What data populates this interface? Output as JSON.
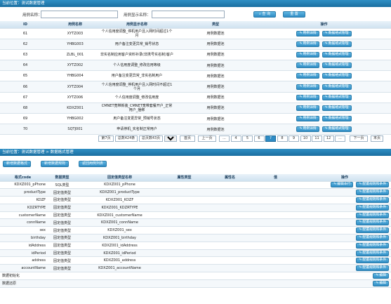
{
  "top": {
    "location": "当前位置：测试数据管理",
    "search": {
      "name_label": "用例名称：",
      "display_label": "用例显示名称：",
      "query_button": "查 询",
      "reset_button": "重 置"
    },
    "columns": [
      "ID",
      "用例名称",
      "用例显示名称",
      "类型",
      "操作"
    ],
    "rows": [
      {
        "id": "61",
        "name": "XYTZ003",
        "display": "个人信用度调整_停机用户且入网时间超过1个月",
        "type": "用例数据池"
      },
      {
        "id": "62",
        "name": "YHBG003",
        "display": "用户备注变更异常_销号状态",
        "type": "用例数据池"
      },
      {
        "id": "63",
        "name": "ZLBL_001",
        "display": "非实名制应用客户资料补录(非携号实名制)客户",
        "type": "用例数据池"
      },
      {
        "id": "64",
        "name": "XYTZ002",
        "display": "个人信用度调整_修改信用等级",
        "type": "用例数据池"
      },
      {
        "id": "65",
        "name": "YHBG004",
        "display": "用户备注变更异常_非实名制用户",
        "type": "用例数据池"
      },
      {
        "id": "66",
        "name": "XYTZ004",
        "display": "个人信用度调整_停机用户且入网时间不超过1个月",
        "type": "用例数据池"
      },
      {
        "id": "67",
        "name": "XYTZ006",
        "display": "个人信用度调整_修改信用度",
        "type": "用例数据池"
      },
      {
        "id": "68",
        "name": "KDXZ001",
        "display": "CMNET宽带新装_CMNET宽带套餐开户_正常用户_捆绑",
        "type": "用例数据池"
      },
      {
        "id": "69",
        "name": "YHBG002",
        "display": "用户备注变更异常_预销号状态",
        "type": "用例数据池"
      },
      {
        "id": "70",
        "name": "SQTJ001",
        "display": "申请停机_实名制正常用户",
        "type": "用例数据池"
      }
    ],
    "row_buttons": [
      "用例详情",
      "数据格式管理"
    ],
    "pager": {
      "page_info": "第7页",
      "total_records": "总数424条",
      "total_pages": "总页数43页",
      "page_size": "10",
      "first": "首页",
      "prev": "上一页",
      "pages": [
        "...",
        "4",
        "5",
        "6",
        "7",
        "8",
        "9",
        "10",
        "11",
        "12",
        "..."
      ],
      "current": "7",
      "next": "下一页",
      "last": "末页"
    }
  },
  "bottom": {
    "location": "当前位置：测试数据管理 > 数据格式管理",
    "buttons": [
      "新增数据格式",
      "新增数据规则",
      "返回用例列表"
    ],
    "columns": [
      "格式code",
      "数据类型",
      "固定值类型名称",
      "属性类型",
      "属性名",
      "值",
      "操作"
    ],
    "rows": [
      {
        "code": "KDXZ001_pPhone",
        "dtype": "SQL类型",
        "fixed": "KDXZ001_pPhone",
        "ops": [
          "编辑本行",
          "配置规则和条件"
        ]
      },
      {
        "code": "productType",
        "dtype": "固定值类型",
        "fixed": "KDXZ001_productType",
        "ops": [
          "配置规则和条件"
        ]
      },
      {
        "code": "KDZF",
        "dtype": "固定值类型",
        "fixed": "KDXZ001_KDZF",
        "ops": [
          "配置规则和条件"
        ]
      },
      {
        "code": "KDZRTYPE",
        "dtype": "固定值类型",
        "fixed": "KDXZ001_KDZRTYPE",
        "ops": [
          "配置规则和条件"
        ]
      },
      {
        "code": "customerName",
        "dtype": "固定值类型",
        "fixed": "KDXZ001_customerName",
        "ops": [
          "配置规则和条件"
        ]
      },
      {
        "code": "connName",
        "dtype": "固定值类型",
        "fixed": "KDXZ001_connName",
        "ops": [
          "配置规则和条件"
        ]
      },
      {
        "code": "sex",
        "dtype": "固定值类型",
        "fixed": "KDXZ001_sex",
        "ops": [
          "配置规则和条件"
        ]
      },
      {
        "code": "birthday",
        "dtype": "固定值类型",
        "fixed": "KDXZ001_birthday",
        "ops": [
          "配置规则和条件"
        ]
      },
      {
        "code": "idAddress",
        "dtype": "固定值类型",
        "fixed": "KDXZ001_idAddress",
        "ops": [
          "配置规则和条件"
        ]
      },
      {
        "code": "idPeriod",
        "dtype": "固定值类型",
        "fixed": "KDXZ001_idPeriod",
        "ops": [
          "配置规则和条件"
        ]
      },
      {
        "code": "address",
        "dtype": "固定值类型",
        "fixed": "KDXZ001_address",
        "ops": [
          "配置规则和条件"
        ]
      },
      {
        "code": "accountName",
        "dtype": "固定值类型",
        "fixed": "KDXZ001_accountName",
        "ops": [
          "配置规则和条件"
        ]
      },
      {
        "code": "数据初始化",
        "dtype": "",
        "fixed": "",
        "ops": [
          "编辑"
        ]
      },
      {
        "code": "数据还原",
        "dtype": "",
        "fixed": "",
        "ops": [
          "编辑"
        ]
      }
    ]
  }
}
